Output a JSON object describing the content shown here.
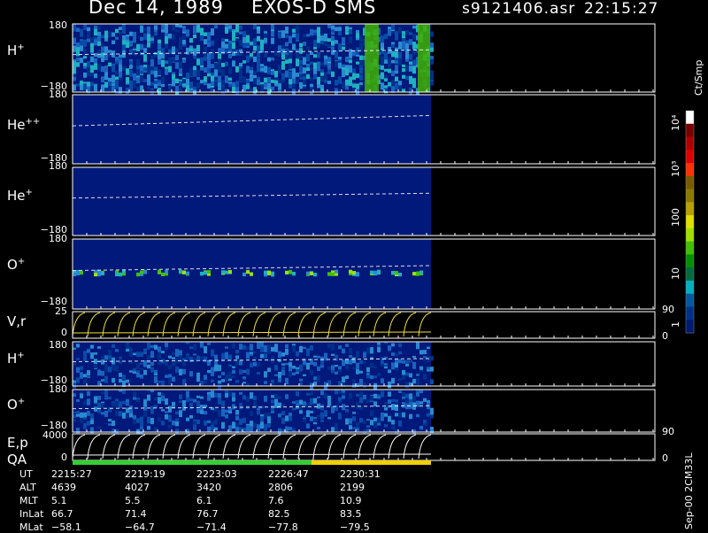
{
  "header": {
    "date": "Dec 14, 1989",
    "mission": "EXOS-D SMS",
    "filename": "s9121406.asr",
    "time": "22:15:27"
  },
  "panels": [
    {
      "label_base": "H",
      "label_sup": "+",
      "top_tick": "180",
      "bottom_tick": "−180"
    },
    {
      "label_base": "He",
      "label_sup": "++",
      "top_tick": "180",
      "bottom_tick": "−180"
    },
    {
      "label_base": "He",
      "label_sup": "+",
      "top_tick": "180",
      "bottom_tick": "−180"
    },
    {
      "label_base": "O",
      "label_sup": "+",
      "top_tick": "180",
      "bottom_tick": "−180"
    },
    {
      "label_base": "V,r",
      "label_sup": "",
      "top_tick": "25",
      "bottom_tick": "0",
      "right_top": "90",
      "right_bottom": "0"
    },
    {
      "label_base": "H",
      "label_sup": "+",
      "top_tick": "180",
      "bottom_tick": "−180"
    },
    {
      "label_base": "O",
      "label_sup": "+",
      "top_tick": "180",
      "bottom_tick": "−180"
    },
    {
      "label_base": "E,p",
      "label_sup": "",
      "label2": "QA",
      "top_tick": "4000",
      "bottom_tick": "0",
      "right_top": "90",
      "right_bottom": "0"
    }
  ],
  "colorbar": {
    "unit": "Ct/Smp",
    "labels": [
      "10⁴",
      "10³",
      "100",
      "10",
      "1"
    ],
    "colors": [
      "#ffffff",
      "#7a0000",
      "#b00000",
      "#e00000",
      "#ff3000",
      "#7a5a00",
      "#8a7a00",
      "#b8a000",
      "#e0e000",
      "#a0e000",
      "#40c000",
      "#009000",
      "#006a40",
      "#00b0c0",
      "#0058a0",
      "#00308a",
      "#001a70"
    ]
  },
  "quality_bar": {
    "colors": [
      "#30d030",
      "#f0d000"
    ]
  },
  "orbit": {
    "labels": [
      "UT",
      "ALT",
      "MLT",
      "InLat",
      "MLat"
    ],
    "columns": [
      [
        "2215:27",
        "4639",
        "5.1",
        "66.7",
        "−58.1"
      ],
      [
        "2219:19",
        "4027",
        "5.5",
        "71.4",
        "−64.7"
      ],
      [
        "2223:03",
        "3420",
        "6.1",
        "76.7",
        "−71.4"
      ],
      [
        "2226:47",
        "2806",
        "7.6",
        "82.5",
        "−77.8"
      ],
      [
        "2230:31",
        "2199",
        "10.9",
        "83.5",
        "−79.5"
      ]
    ]
  },
  "footer": {
    "version": "Sep-00 2CM33L"
  },
  "chart_data": [
    {
      "type": "heatmap",
      "title": "H+",
      "ylabel": "H+",
      "ylim": [
        -180,
        180
      ],
      "x": [
        "2215:27",
        "2219:19",
        "2223:03",
        "2226:47",
        "2230:31"
      ]
    },
    {
      "type": "heatmap",
      "title": "He++",
      "ylabel": "He++",
      "ylim": [
        -180,
        180
      ]
    },
    {
      "type": "heatmap",
      "title": "He+",
      "ylabel": "He+",
      "ylim": [
        -180,
        180
      ]
    },
    {
      "type": "heatmap",
      "title": "O+",
      "ylabel": "O+",
      "ylim": [
        -180,
        180
      ]
    },
    {
      "type": "line",
      "title": "V,r",
      "ylabel": "V,r",
      "ylim": [
        0,
        25
      ],
      "y2lim": [
        0,
        90
      ]
    },
    {
      "type": "heatmap",
      "title": "H+",
      "ylabel": "H+",
      "ylim": [
        -180,
        180
      ]
    },
    {
      "type": "heatmap",
      "title": "O+",
      "ylabel": "O+",
      "ylim": [
        -180,
        180
      ]
    },
    {
      "type": "line",
      "title": "E,p",
      "ylabel": "E,p",
      "ylim": [
        0,
        4000
      ],
      "y2lim": [
        0,
        90
      ]
    }
  ]
}
